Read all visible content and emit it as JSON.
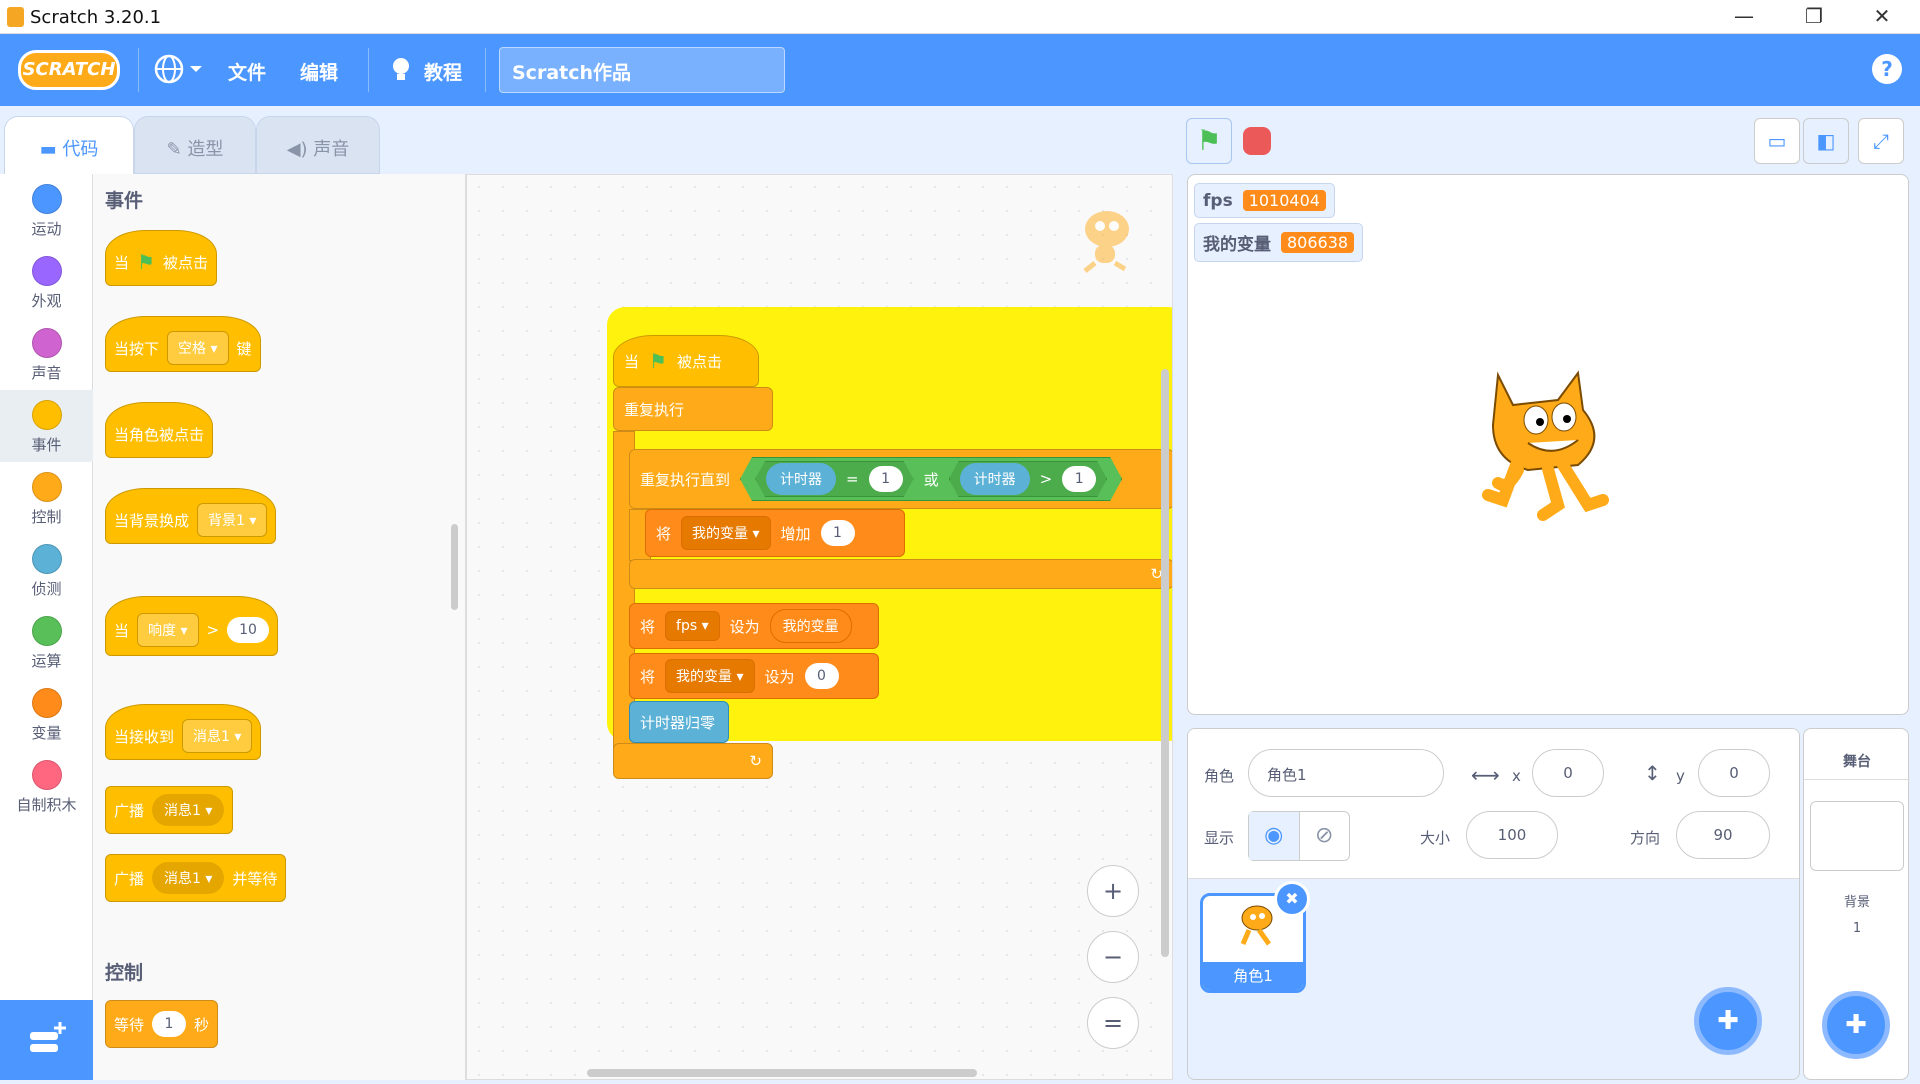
{
  "window": {
    "title": "Scratch 3.20.1",
    "minimize": "—",
    "restore": "❐",
    "close": "✕"
  },
  "menu": {
    "logo": "SCRATCH",
    "language_icon": "globe-icon",
    "file": "文件",
    "edit": "编辑",
    "tutorials": "教程",
    "project_title": "Scratch作品",
    "help": "?"
  },
  "tabs": [
    {
      "label": "代码"
    },
    {
      "label": "造型"
    },
    {
      "label": "声音"
    }
  ],
  "categories": [
    {
      "label": "运动",
      "color": "#4c97ff"
    },
    {
      "label": "外观",
      "color": "#9966ff"
    },
    {
      "label": "声音",
      "color": "#cf63cf"
    },
    {
      "label": "事件",
      "color": "#ffbf00"
    },
    {
      "label": "控制",
      "color": "#ffab19"
    },
    {
      "label": "侦测",
      "color": "#5cb1d6"
    },
    {
      "label": "运算",
      "color": "#59c059"
    },
    {
      "label": "变量",
      "color": "#ff8c1a"
    },
    {
      "label": "自制积木",
      "color": "#ff6680"
    }
  ],
  "palette": {
    "events_title": "事件",
    "b1": {
      "a": "当",
      "b": "被点击"
    },
    "b2": {
      "a": "当按下",
      "key": "空格",
      "b": "键"
    },
    "b3": {
      "a": "当角色被点击"
    },
    "b4": {
      "a": "当背景换成",
      "backdrop": "背景1"
    },
    "b5": {
      "a": "当",
      "sensor": "响度",
      "op": ">",
      "val": "10"
    },
    "b6": {
      "a": "当接收到",
      "msg": "消息1"
    },
    "b7": {
      "a": "广播",
      "msg": "消息1"
    },
    "b8": {
      "a": "广播",
      "msg": "消息1",
      "b": "并等待"
    },
    "control_title": "控制",
    "b9": {
      "a": "等待",
      "val": "1",
      "b": "秒"
    }
  },
  "script": {
    "hat": {
      "a": "当",
      "b": "被点击"
    },
    "forever": "重复执行",
    "repeat_until": "重复执行直到",
    "cond1": {
      "reporter": "计时器",
      "op": "=",
      "val": "1"
    },
    "or": "或",
    "cond2": {
      "reporter": "计时器",
      "op": ">",
      "val": "1"
    },
    "change": {
      "a": "将",
      "var": "我的变量",
      "b": "增加",
      "val": "1"
    },
    "set1": {
      "a": "将",
      "var": "fps",
      "b": "设为",
      "val": "我的变量"
    },
    "set2": {
      "a": "将",
      "var": "我的变量",
      "b": "设为",
      "val": "0"
    },
    "reset_timer": "计时器归零"
  },
  "zoom": {
    "in": "+",
    "out": "−",
    "reset": "="
  },
  "monitors": [
    {
      "name": "fps",
      "value": "1010404"
    },
    {
      "name": "我的变量",
      "value": "806638"
    }
  ],
  "sprite_info": {
    "sprite_label": "角色",
    "sprite_name": "角色1",
    "x_label": "x",
    "x": "0",
    "y_label": "y",
    "y": "0",
    "show_label": "显示",
    "size_label": "大小",
    "size": "100",
    "direction_label": "方向",
    "direction": "90"
  },
  "sprites": [
    {
      "name": "角色1"
    }
  ],
  "stage_panel": {
    "title": "舞台",
    "backdrops_label": "背景",
    "backdrops_count": "1"
  }
}
